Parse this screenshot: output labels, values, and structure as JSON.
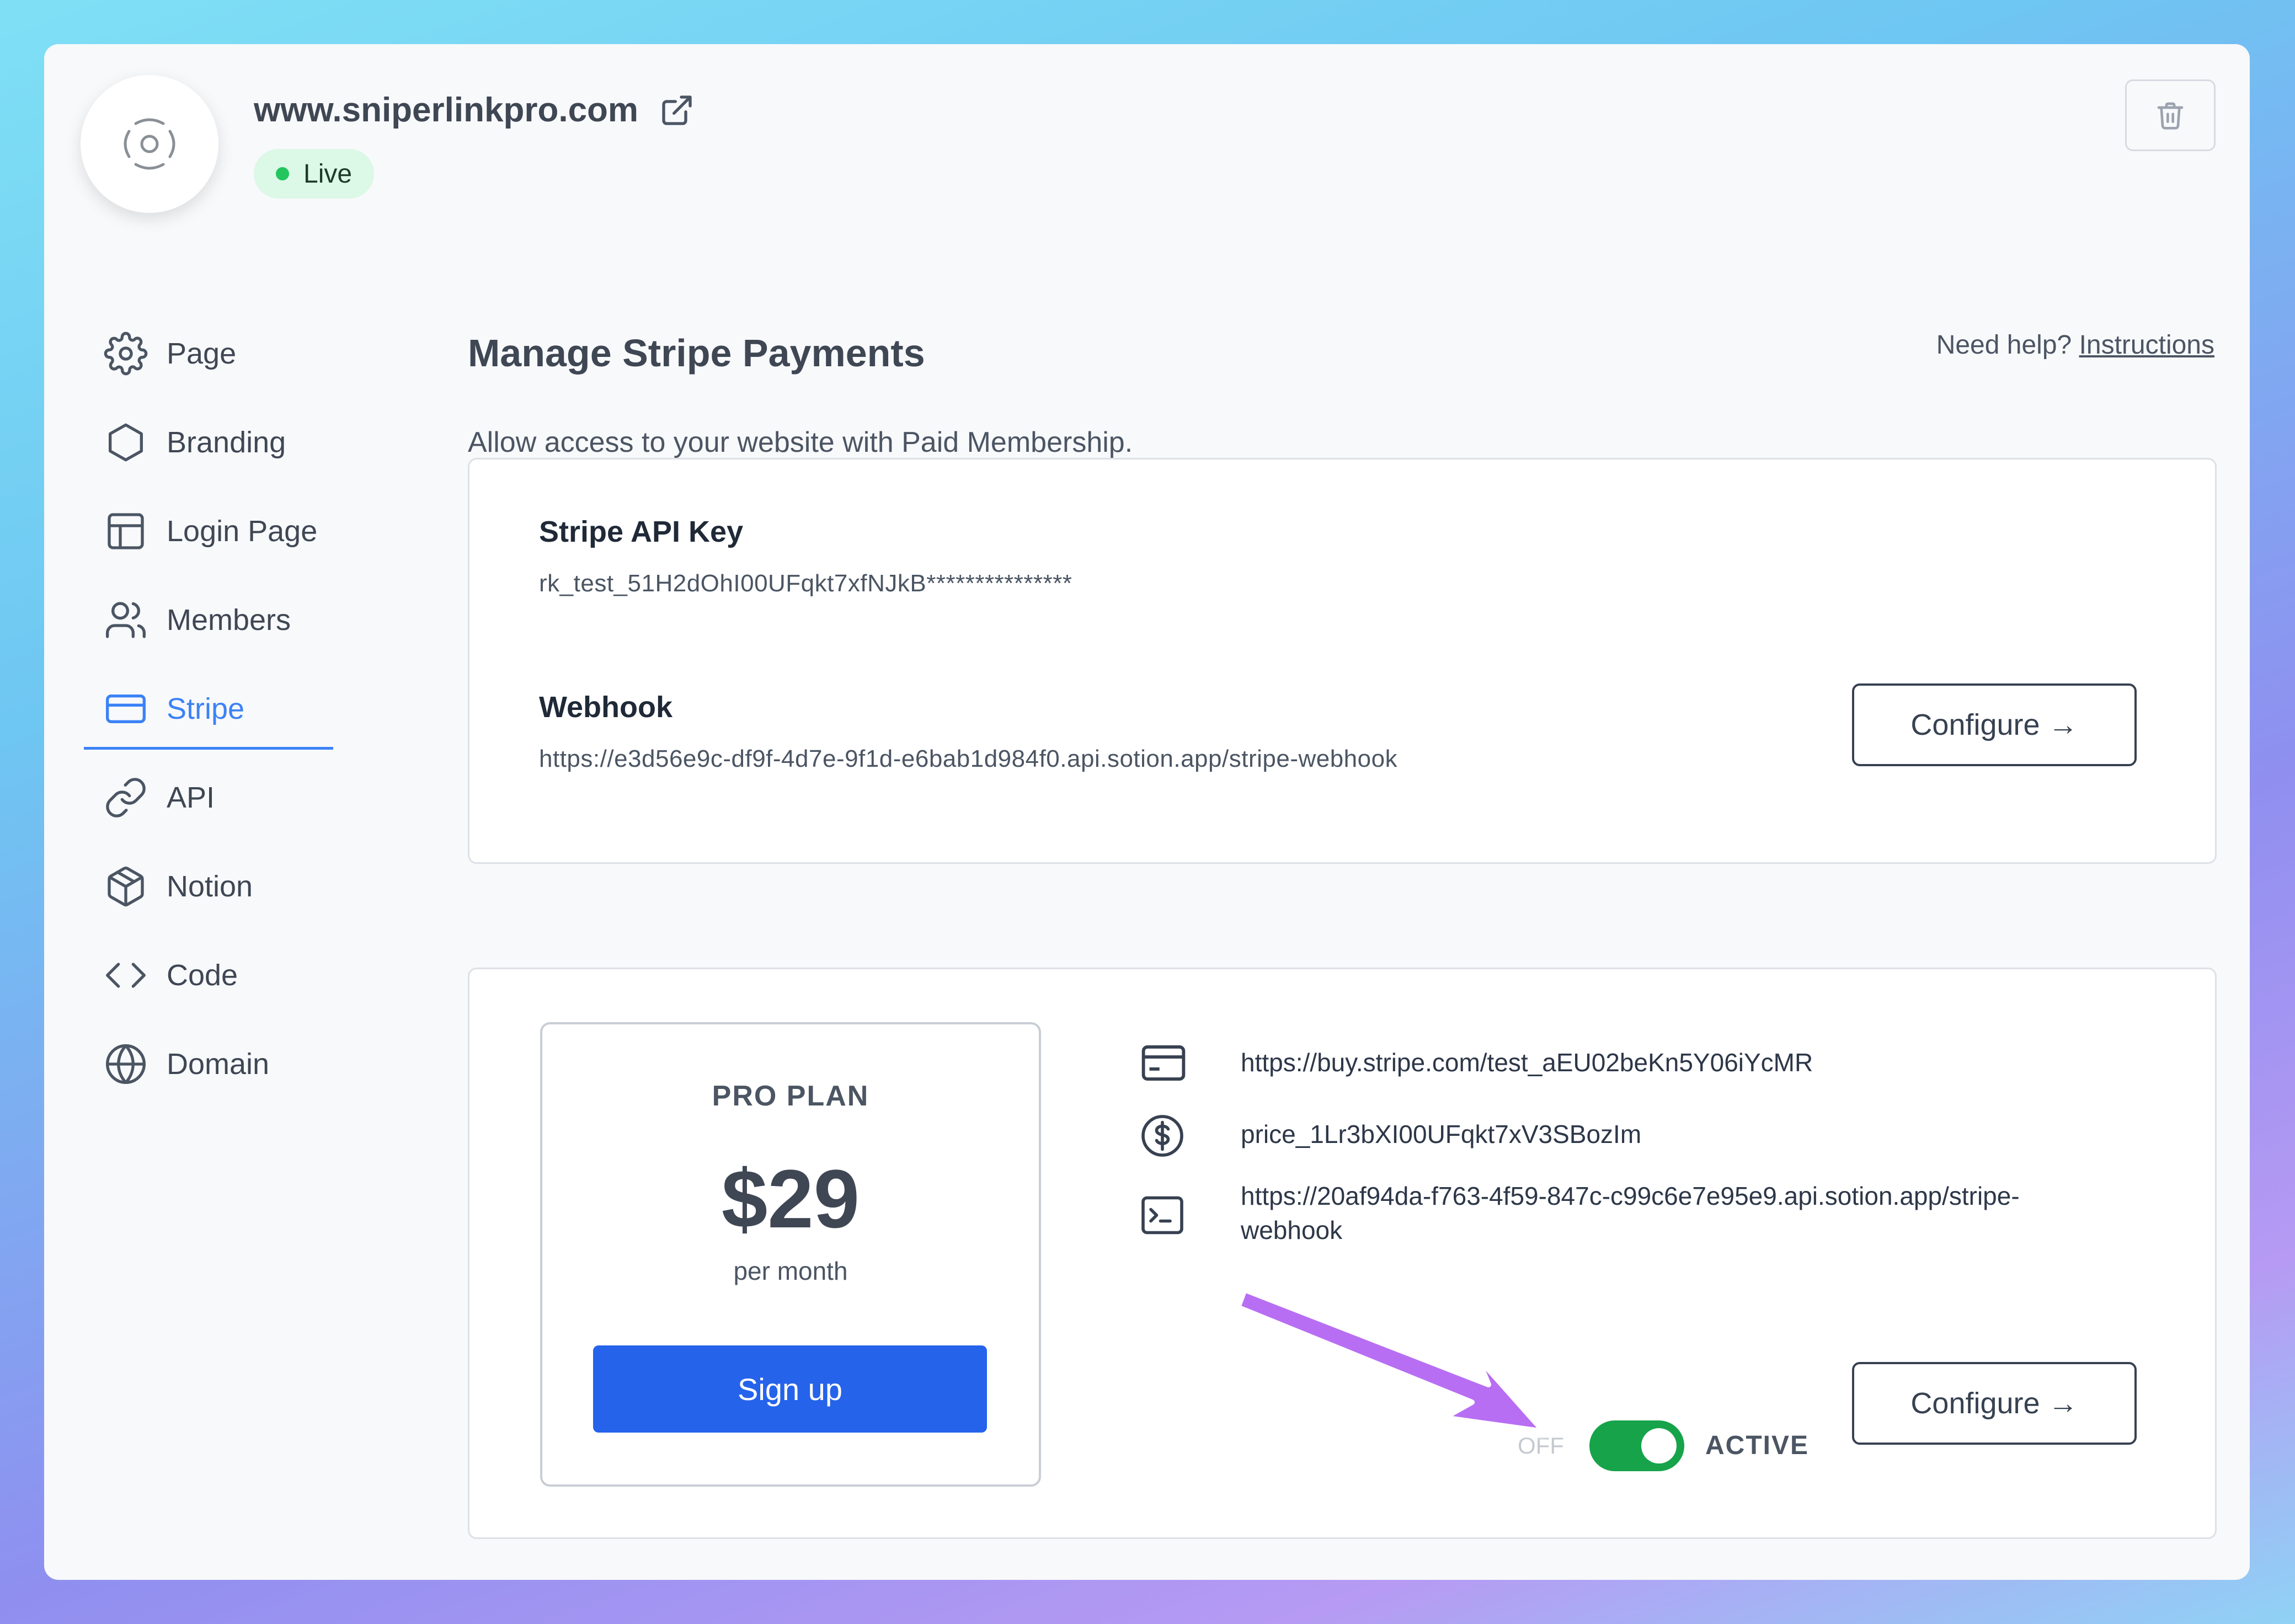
{
  "header": {
    "site_title": "www.sniperlinkpro.com",
    "status": "Live"
  },
  "sidebar": {
    "items": [
      {
        "label": "Page",
        "icon": "gear-icon"
      },
      {
        "label": "Branding",
        "icon": "hexagon-icon"
      },
      {
        "label": "Login Page",
        "icon": "layout-icon"
      },
      {
        "label": "Members",
        "icon": "users-icon"
      },
      {
        "label": "Stripe",
        "icon": "credit-card-icon",
        "active": true
      },
      {
        "label": "API",
        "icon": "link-icon"
      },
      {
        "label": "Notion",
        "icon": "cube-icon"
      },
      {
        "label": "Code",
        "icon": "code-icon"
      },
      {
        "label": "Domain",
        "icon": "globe-icon"
      }
    ]
  },
  "main": {
    "title": "Manage Stripe Payments",
    "help_prefix": "Need help?",
    "help_link": "Instructions",
    "subtitle": "Allow access to your website with Paid Membership.",
    "api_card": {
      "api_key_label": "Stripe API Key",
      "api_key_value": "rk_test_51H2dOhI00UFqkt7xfNJkB***************",
      "webhook_label": "Webhook",
      "webhook_value": "https://e3d56e9c-df9f-4d7e-9f1d-e6bab1d984f0.api.sotion.app/stripe-webhook",
      "configure_label": "Configure →"
    },
    "plan_card": {
      "plan_name": "PRO PLAN",
      "price": "$29",
      "period": "per month",
      "signup_label": "Sign up",
      "payment_link": "https://buy.stripe.com/test_aEU02beKn5Y06iYcMR",
      "price_id": "price_1Lr3bXI00UFqkt7xV3SBozIm",
      "webhook_line1": "https://20af94da-f763-4f59-847c-c99c6e7e95e9.api.sotion.app/stripe-",
      "webhook_line2": "webhook",
      "off_label": "OFF",
      "active_label": "ACTIVE",
      "toggle_on": true,
      "configure_label": "Configure →"
    }
  },
  "colors": {
    "accent": "#3b82f6",
    "signup": "#2563eb",
    "toggle_on": "#16a34a",
    "live_badge": "#dcf8e6",
    "annotation_arrow": "#b86ef3"
  }
}
